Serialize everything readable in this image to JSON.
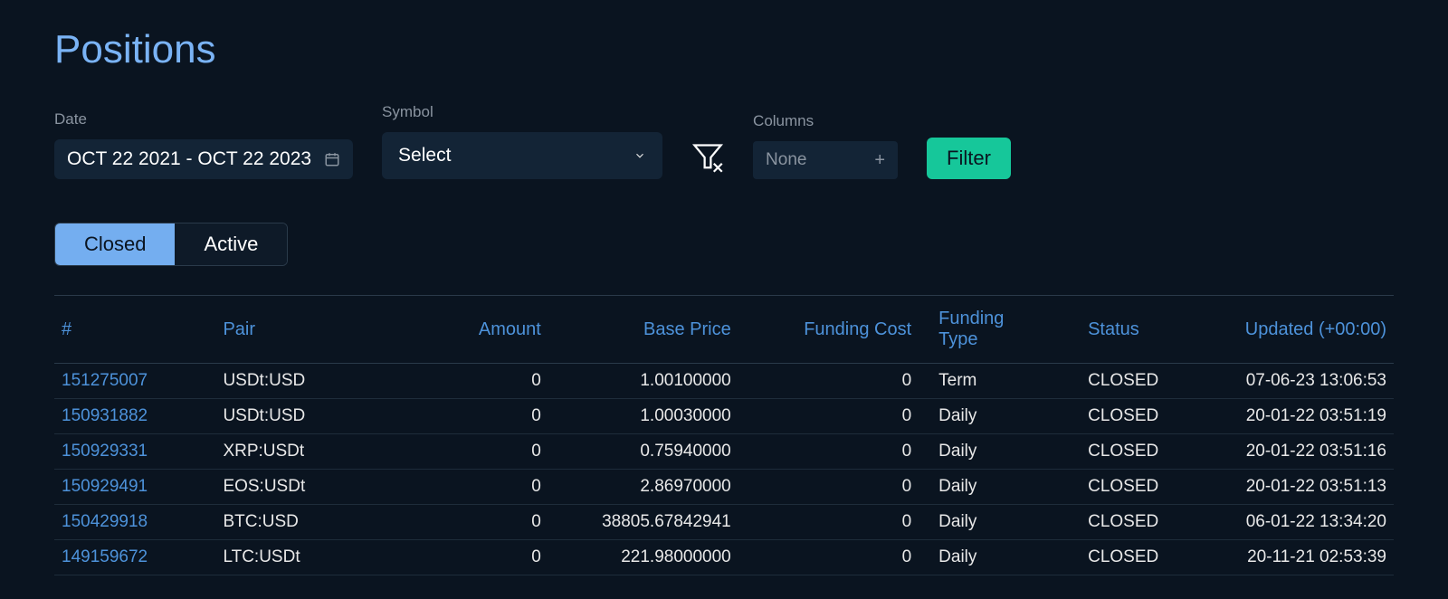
{
  "title": "Positions",
  "filters": {
    "date": {
      "label": "Date",
      "value": "OCT 22 2021 - OCT 22 2023"
    },
    "symbol": {
      "label": "Symbol",
      "placeholder": "Select"
    },
    "columns": {
      "label": "Columns",
      "placeholder": "None"
    },
    "filter_button": "Filter"
  },
  "tabs": {
    "closed": "Closed",
    "active": "Active",
    "selected": "closed"
  },
  "table": {
    "headers": {
      "id": "#",
      "pair": "Pair",
      "amount": "Amount",
      "base_price": "Base Price",
      "funding_cost": "Funding Cost",
      "funding_type": "Funding Type",
      "status": "Status",
      "updated": "Updated (+00:00)"
    },
    "rows": [
      {
        "id": "151275007",
        "pair": "USDt:USD",
        "amount": "0",
        "base_price": "1.00100000",
        "funding_cost": "0",
        "funding_type": "Term",
        "status": "CLOSED",
        "updated": "07-06-23 13:06:53"
      },
      {
        "id": "150931882",
        "pair": "USDt:USD",
        "amount": "0",
        "base_price": "1.00030000",
        "funding_cost": "0",
        "funding_type": "Daily",
        "status": "CLOSED",
        "updated": "20-01-22 03:51:19"
      },
      {
        "id": "150929331",
        "pair": "XRP:USDt",
        "amount": "0",
        "base_price": "0.75940000",
        "funding_cost": "0",
        "funding_type": "Daily",
        "status": "CLOSED",
        "updated": "20-01-22 03:51:16"
      },
      {
        "id": "150929491",
        "pair": "EOS:USDt",
        "amount": "0",
        "base_price": "2.86970000",
        "funding_cost": "0",
        "funding_type": "Daily",
        "status": "CLOSED",
        "updated": "20-01-22 03:51:13"
      },
      {
        "id": "150429918",
        "pair": "BTC:USD",
        "amount": "0",
        "base_price": "38805.67842941",
        "funding_cost": "0",
        "funding_type": "Daily",
        "status": "CLOSED",
        "updated": "06-01-22 13:34:20"
      },
      {
        "id": "149159672",
        "pair": "LTC:USDt",
        "amount": "0",
        "base_price": "221.98000000",
        "funding_cost": "0",
        "funding_type": "Daily",
        "status": "CLOSED",
        "updated": "20-11-21 02:53:39"
      }
    ]
  },
  "colors": {
    "background": "#0a1420",
    "panel": "#132436",
    "accent_blue": "#74aef0",
    "link_blue": "#4d92da",
    "accent_green": "#16c79a",
    "text_muted": "#8a94a0"
  }
}
